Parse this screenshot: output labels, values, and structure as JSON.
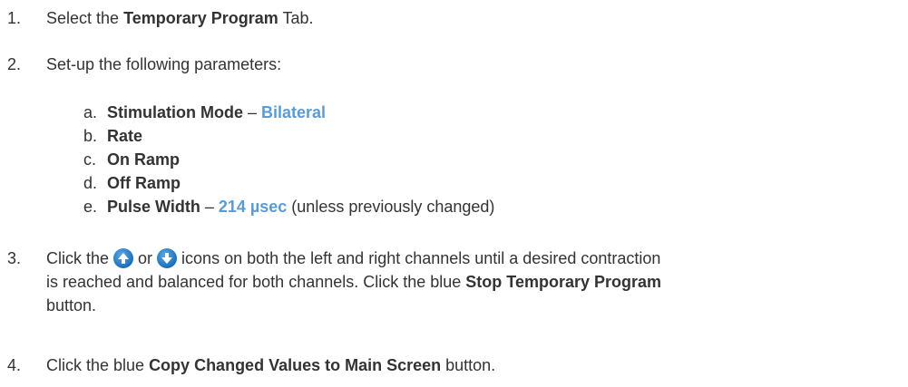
{
  "steps": [
    {
      "num": "1.",
      "pre": "Select the ",
      "bold": "Temporary Program",
      "post": " Tab."
    },
    {
      "num": "2.",
      "text": "Set-up the following parameters:"
    },
    {
      "num": "3.",
      "t1": "Click the ",
      "t2": " or ",
      "t3": " icons on both the left and right channels until a desired contraction",
      "t4": "is reached and balanced for both channels. Click the blue ",
      "b": "Stop Temporary Program",
      "t5": "button."
    },
    {
      "num": "4.",
      "pre": "Click the blue ",
      "bold": "Copy Changed Values to Main Screen",
      "post": " button."
    }
  ],
  "params": [
    {
      "letter": "a.",
      "name": "Stimulation Mode",
      "sep": " – ",
      "value": "Bilateral",
      "note": ""
    },
    {
      "letter": "b.",
      "name": "Rate"
    },
    {
      "letter": "c.",
      "name": "On Ramp"
    },
    {
      "letter": "d.",
      "name": "Off Ramp"
    },
    {
      "letter": "e.",
      "name": "Pulse Width",
      "sep": " – ",
      "value": "214 µsec",
      "note": " (unless previously changed)"
    }
  ],
  "icons": [
    "arrow-up-icon",
    "arrow-down-icon"
  ],
  "colors": {
    "text": "#333333",
    "accent": "#5b9bd5",
    "icon": "#1d6fb8"
  }
}
